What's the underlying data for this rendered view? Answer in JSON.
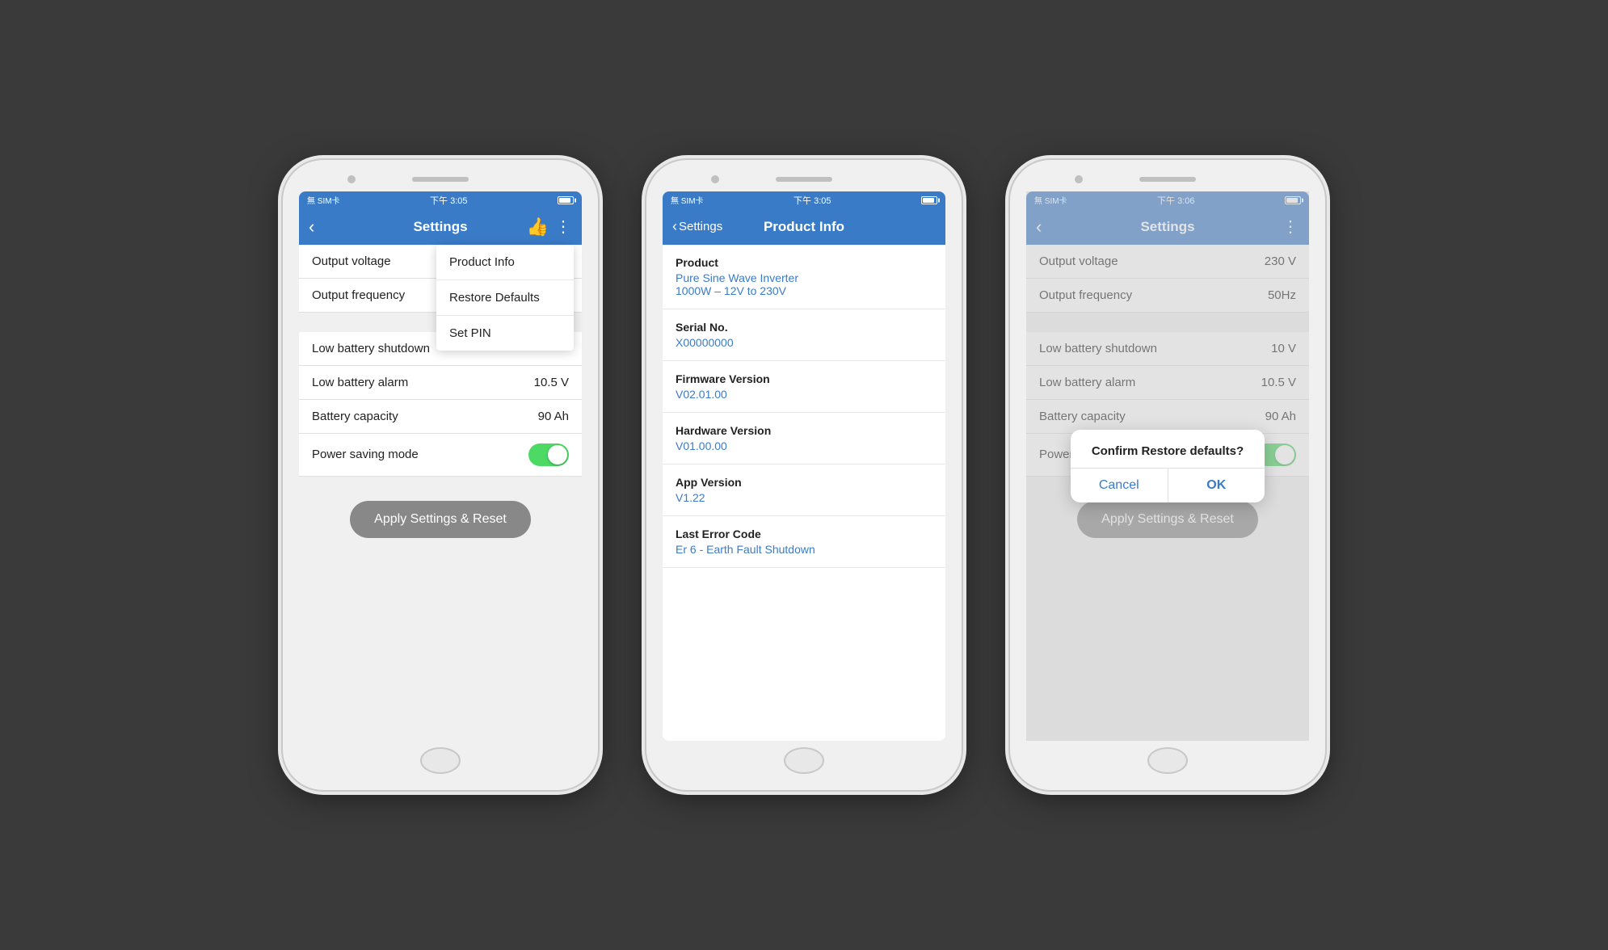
{
  "page": {
    "background": "#3a3a3a"
  },
  "phones": [
    {
      "id": "phone1",
      "statusBar": {
        "left": "無 SIM卡",
        "center": "下午 3:05",
        "right": "battery"
      },
      "screen": "settings-menu",
      "navTitle": "Settings",
      "settingsItems": [
        {
          "label": "Output voltage",
          "value": ""
        },
        {
          "label": "Output frequency",
          "value": ""
        },
        {
          "label": "Low battery shutdown",
          "value": ""
        },
        {
          "label": "Low battery alarm",
          "value": "10.5 V"
        },
        {
          "label": "Battery capacity",
          "value": "90 Ah"
        },
        {
          "label": "Power saving mode",
          "value": "toggle"
        }
      ],
      "dropdownItems": [
        "Product Info",
        "Restore Defaults",
        "Set PIN"
      ],
      "applyBtn": "Apply Settings & Reset"
    },
    {
      "id": "phone2",
      "statusBar": {
        "left": "無 SIM卡",
        "center": "下午 3:05",
        "right": "battery"
      },
      "screen": "product-info",
      "navBackText": "Settings",
      "navTitle": "Product Info",
      "productInfo": [
        {
          "label": "Product",
          "value": "Pure Sine Wave Inverter\n1000W – 12V to 230V"
        },
        {
          "label": "Serial No.",
          "value": "X00000000"
        },
        {
          "label": "Firmware Version",
          "value": "V02.01.00"
        },
        {
          "label": "Hardware Version",
          "value": "V01.00.00"
        },
        {
          "label": "App Version",
          "value": "V1.22"
        },
        {
          "label": "Last Error Code",
          "value": "Er 6 - Earth Fault Shutdown"
        }
      ]
    },
    {
      "id": "phone3",
      "statusBar": {
        "left": "無 SIM卡",
        "center": "下午 3:06",
        "right": "battery"
      },
      "screen": "settings-dialog",
      "navTitle": "Settings",
      "settingsItems": [
        {
          "label": "Output voltage",
          "value": "230 V"
        },
        {
          "label": "Output frequency",
          "value": "50Hz"
        },
        {
          "label": "Low battery shutdown",
          "value": "10 V"
        },
        {
          "label": "Low battery alarm",
          "value": "10.5 V"
        },
        {
          "label": "Battery capacity",
          "value": "90 Ah"
        },
        {
          "label": "Power saving mode",
          "value": "toggle"
        }
      ],
      "applyBtn": "Apply Settings & Reset",
      "dialog": {
        "title": "Confirm Restore defaults?",
        "cancelLabel": "Cancel",
        "okLabel": "OK"
      }
    }
  ]
}
